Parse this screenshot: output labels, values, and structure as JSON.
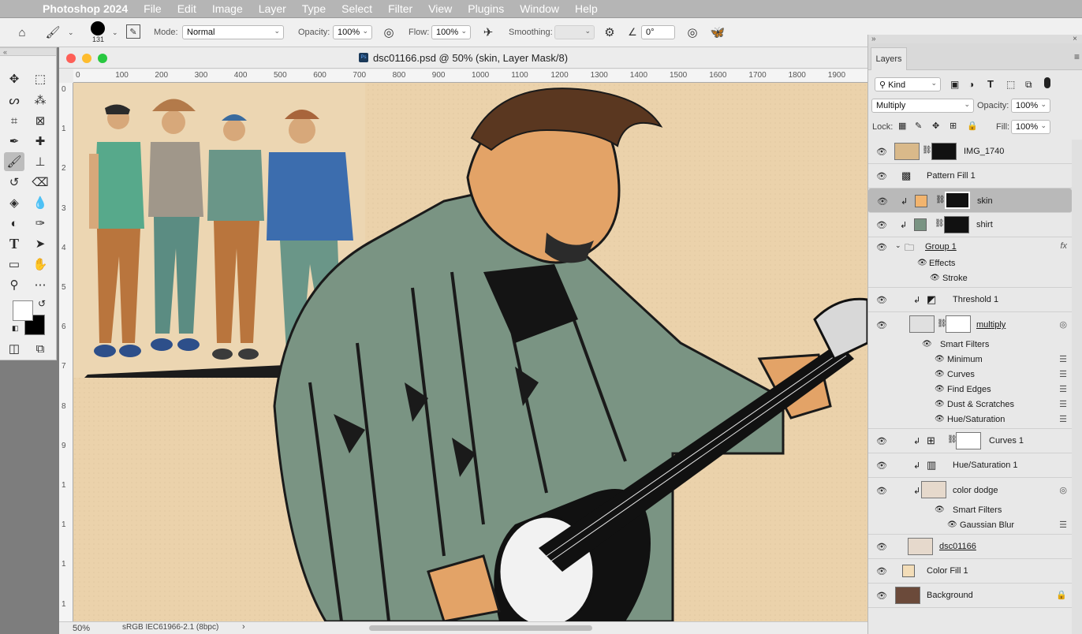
{
  "menubar": {
    "app_name": "Photoshop 2024",
    "items": [
      "File",
      "Edit",
      "Image",
      "Layer",
      "Type",
      "Select",
      "Filter",
      "View",
      "Plugins",
      "Window",
      "Help"
    ]
  },
  "options_bar": {
    "brush_size": "131",
    "mode_label": "Mode:",
    "mode_value": "Normal",
    "opacity_label": "Opacity:",
    "opacity_value": "100%",
    "flow_label": "Flow:",
    "flow_value": "100%",
    "smoothing_label": "Smoothing:",
    "smoothing_value": "",
    "angle_value": "0°"
  },
  "document": {
    "title": "dsc01166.psd @ 50% (skin, Layer Mask/8)",
    "zoom": "50%",
    "color_profile": "sRGB IEC61966-2.1 (8bpc)",
    "ruler_top": [
      "0",
      "100",
      "200",
      "300",
      "400",
      "500",
      "600",
      "700",
      "800",
      "900",
      "1000",
      "1100",
      "1200",
      "1300",
      "1400",
      "1500",
      "1600",
      "1700",
      "1800",
      "1900"
    ],
    "ruler_left": [
      "0",
      "1",
      "2",
      "3",
      "4",
      "5",
      "6",
      "7",
      "8",
      "9",
      "1",
      "1",
      "1",
      "1"
    ]
  },
  "layers_panel": {
    "tab_label": "Layers",
    "filter_kind": "Kind",
    "blend_mode": "Multiply",
    "opacity_label": "Opacity:",
    "opacity_value": "100%",
    "lock_label": "Lock:",
    "fill_label": "Fill:",
    "fill_value": "100%",
    "layers": [
      {
        "name": "IMG_1740"
      },
      {
        "name": "Pattern Fill 1"
      },
      {
        "name": "skin"
      },
      {
        "name": "shirt"
      },
      {
        "name": "Group 1"
      },
      {
        "name": "Effects"
      },
      {
        "name": "Stroke"
      },
      {
        "name": "Threshold 1"
      },
      {
        "name": "multiply"
      },
      {
        "name": "Smart Filters"
      },
      {
        "name": "Minimum"
      },
      {
        "name": "Curves"
      },
      {
        "name": "Find Edges"
      },
      {
        "name": "Dust & Scratches"
      },
      {
        "name": "Hue/Saturation"
      },
      {
        "name": "Curves 1"
      },
      {
        "name": "Hue/Saturation 1"
      },
      {
        "name": "color dodge"
      },
      {
        "name": "Smart Filters"
      },
      {
        "name": "Gaussian Blur"
      },
      {
        "name": "dsc01166"
      },
      {
        "name": "Color Fill 1"
      },
      {
        "name": "Background"
      }
    ]
  },
  "colors": {
    "canvas_bg": "#ebd2ab",
    "shirt": "#7a9483",
    "skin": "#e3a367",
    "selected_layer": "#b9b9b9"
  }
}
